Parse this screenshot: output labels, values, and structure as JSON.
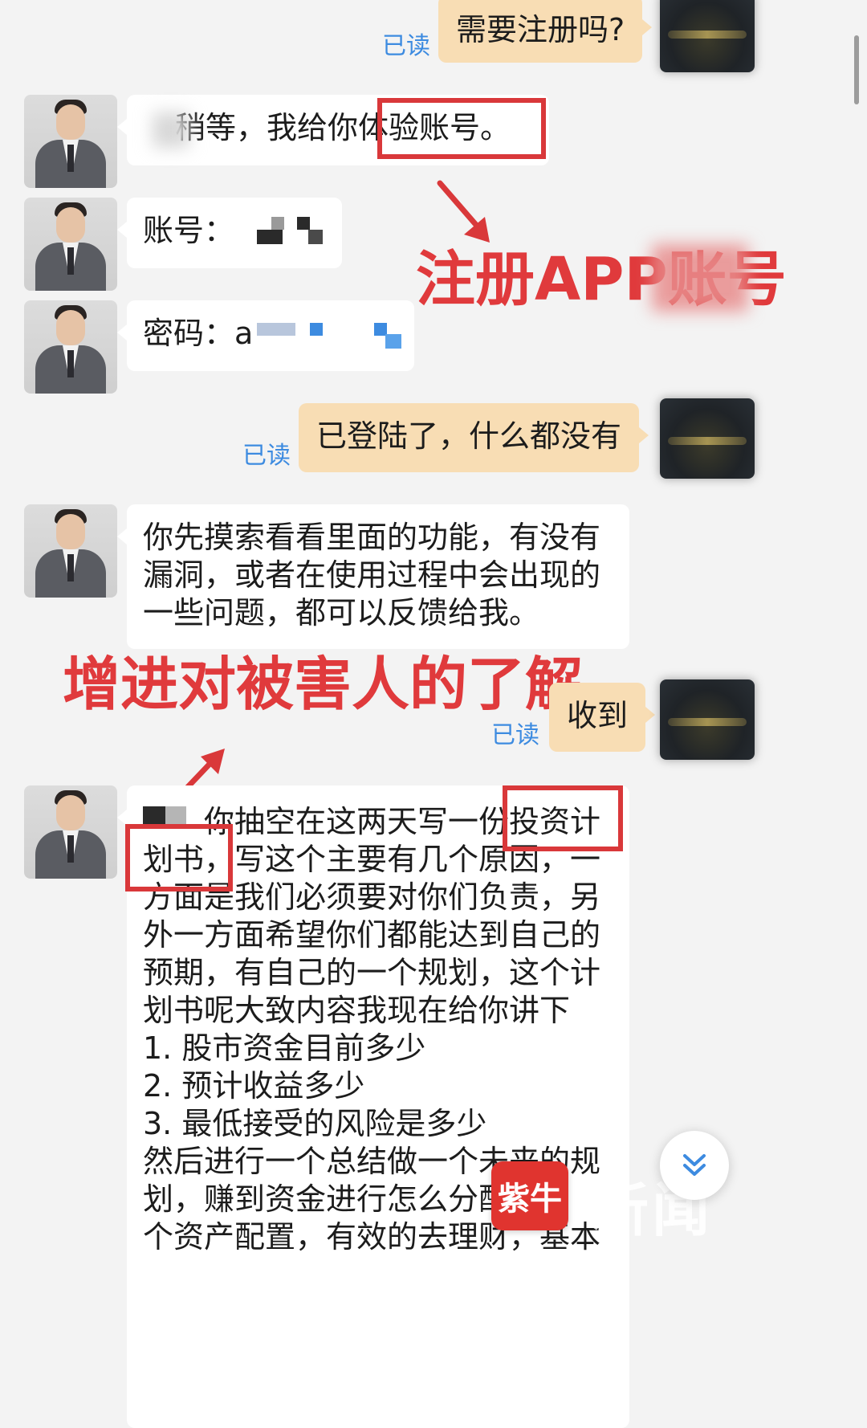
{
  "messages": [
    {
      "side": "out",
      "text": "需要注册吗?",
      "read": "已读"
    },
    {
      "side": "in",
      "text": "稍等，我给你体验账号。"
    },
    {
      "side": "in",
      "label": "账号："
    },
    {
      "side": "in",
      "label": "密码：",
      "value_prefix": "a"
    },
    {
      "side": "out",
      "text": "已登陆了，什么都没有",
      "read": "已读"
    },
    {
      "side": "in",
      "lines": [
        "你先摸索看看里面的功能，有没有",
        "漏洞，或者在使用过程中会出现的",
        "一些问题，都可以反馈给我。"
      ]
    },
    {
      "side": "out",
      "text": "收到",
      "read": "已读"
    },
    {
      "side": "in",
      "lines": [
        "你抽空在这两天写一份投资计",
        "划书，写这个主要有几个原因，一",
        "方面是我们必须要对你们负责，另",
        "外一方面希望你们都能达到自己的",
        "预期，有自己的一个规划，这个计",
        "划书呢大致内容我现在给你讲下",
        "1. 股市资金目前多少",
        "2. 预计收益多少",
        "3. 最低接受的风险是多少",
        "然后进行一个总结做一个未来的规",
        "划，赚到资金进行怎么分配做--",
        "个资产配置，有效的去理财，基本"
      ]
    }
  ],
  "annotations": {
    "register_app": "注册APP账号",
    "understand_victim": "增进对被害人的了解"
  },
  "watermark": {
    "logo": "紫牛",
    "text": "新闻"
  },
  "colors": {
    "annotation": "#d9383a",
    "outgoing": "#f8ddb4",
    "incoming": "#ffffff",
    "read": "#3d8be0",
    "background": "#f3f3f3"
  },
  "icons": {
    "scroll_down": "double-chevron-down-icon"
  }
}
